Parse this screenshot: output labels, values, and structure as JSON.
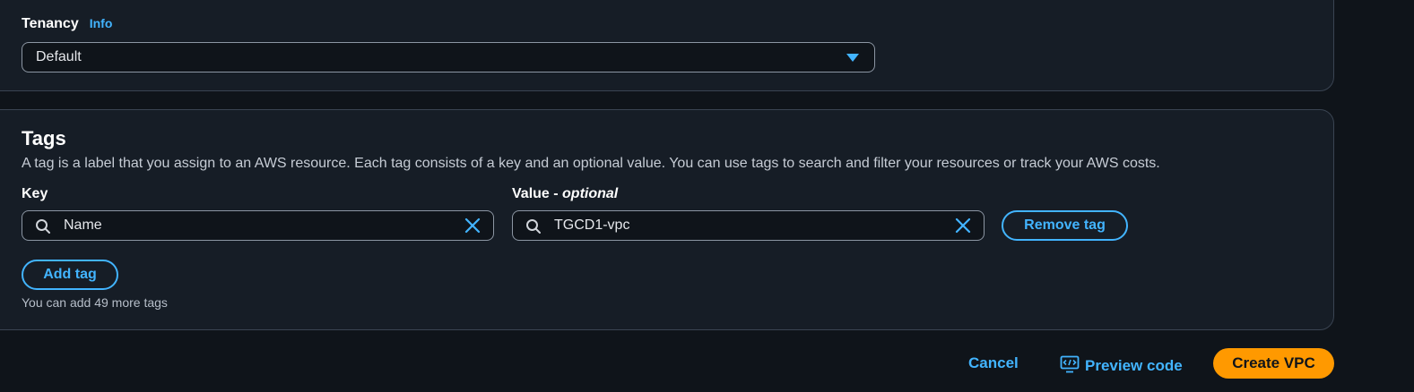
{
  "tenancy": {
    "label": "Tenancy",
    "info": "Info",
    "selected": "Default"
  },
  "tags": {
    "title": "Tags",
    "description": "A tag is a label that you assign to an AWS resource. Each tag consists of a key and an optional value. You can use tags to search and filter your resources or track your AWS costs.",
    "key_label": "Key",
    "value_label": "Value -",
    "value_optional": "optional",
    "rows": [
      {
        "key": "Name",
        "value": "TGCD1-vpc",
        "remove_label": "Remove tag"
      }
    ],
    "add_label": "Add tag",
    "hint": "You can add 49 more tags"
  },
  "footer": {
    "cancel": "Cancel",
    "preview": "Preview code",
    "create": "Create VPC"
  },
  "colors": {
    "accent": "#42b4ff",
    "primary": "#ff9900",
    "background": "#0f141a",
    "panel": "#161d26"
  },
  "icons": [
    "chevron-down-icon",
    "search-icon",
    "clear-icon",
    "preview-code-icon"
  ]
}
